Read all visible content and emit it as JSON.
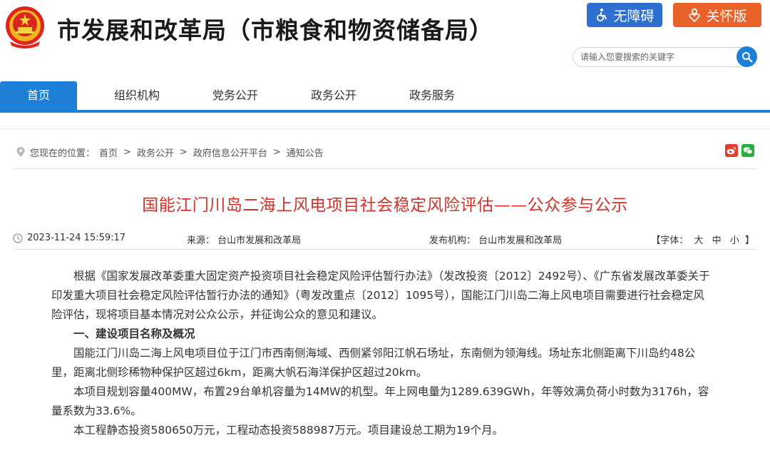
{
  "header": {
    "site_title": "市发展和改革局（市粮食和物资储备局）",
    "accessible_label": "无障碍",
    "care_label": "关怀版",
    "search_placeholder": "请输入您要搜索的关键字"
  },
  "nav": {
    "items": [
      "首页",
      "组织机构",
      "党务公开",
      "政务公开",
      "政务服务"
    ],
    "active_index": 0
  },
  "breadcrumb": {
    "prefix": "您现在的位置：",
    "items": [
      "首页",
      "政务公开",
      "政府信息公开平台",
      "通知公告"
    ],
    "separator": ">"
  },
  "article": {
    "title": "国能江门川岛二海上风电项目社会稳定风险评估——公众参与公示",
    "datetime": "2023-11-24 15:59:17",
    "source_label": "来源：",
    "source": "台山市发展和改革局",
    "publisher_label": "发布机构：",
    "publisher": "台山市发展和改革局",
    "font_label_open": "【字体：",
    "font_sizes": [
      "大",
      "中",
      "小"
    ],
    "font_label_close": "】",
    "paragraphs": [
      "根据《国家发展改革委重大固定资产投资项目社会稳定风险评估暂行办法》（发改投资〔2012〕2492号）、《广东省发展改革委关于印发重大项目社会稳定风险评估暂行办法的通知》（粤发改重点〔2012〕1095号），国能江门川岛二海上风电项目需要进行社会稳定风险评估，现将项目基本情况对公众公示，并征询公众的意见和建议。",
      "国能江门川岛二海上风电项目位于江门市西南侧海域、西侧紧邻阳江帆石场址，东南侧为领海线。场址东北侧距离下川岛约48公里，距离北侧珍稀物种保护区超过6km，距离大帆石海洋保护区超过20km。",
      "本项目规划容量400MW，布置29台单机容量为14MW的机型。年上网电量为1289.639GWh，年等效满负荷小时数为3176h，容量系数为33.6%。",
      "本工程静态投资580650万元，工程动态投资588987万元。项目建设总工期为19个月。"
    ],
    "section1_heading": "一、建设项目名称及概况"
  },
  "colors": {
    "brand_blue": "#1e7fd6",
    "title_red": "#d6302a",
    "care_orange": "#e8622a",
    "access_blue": "#2f6fcf"
  }
}
